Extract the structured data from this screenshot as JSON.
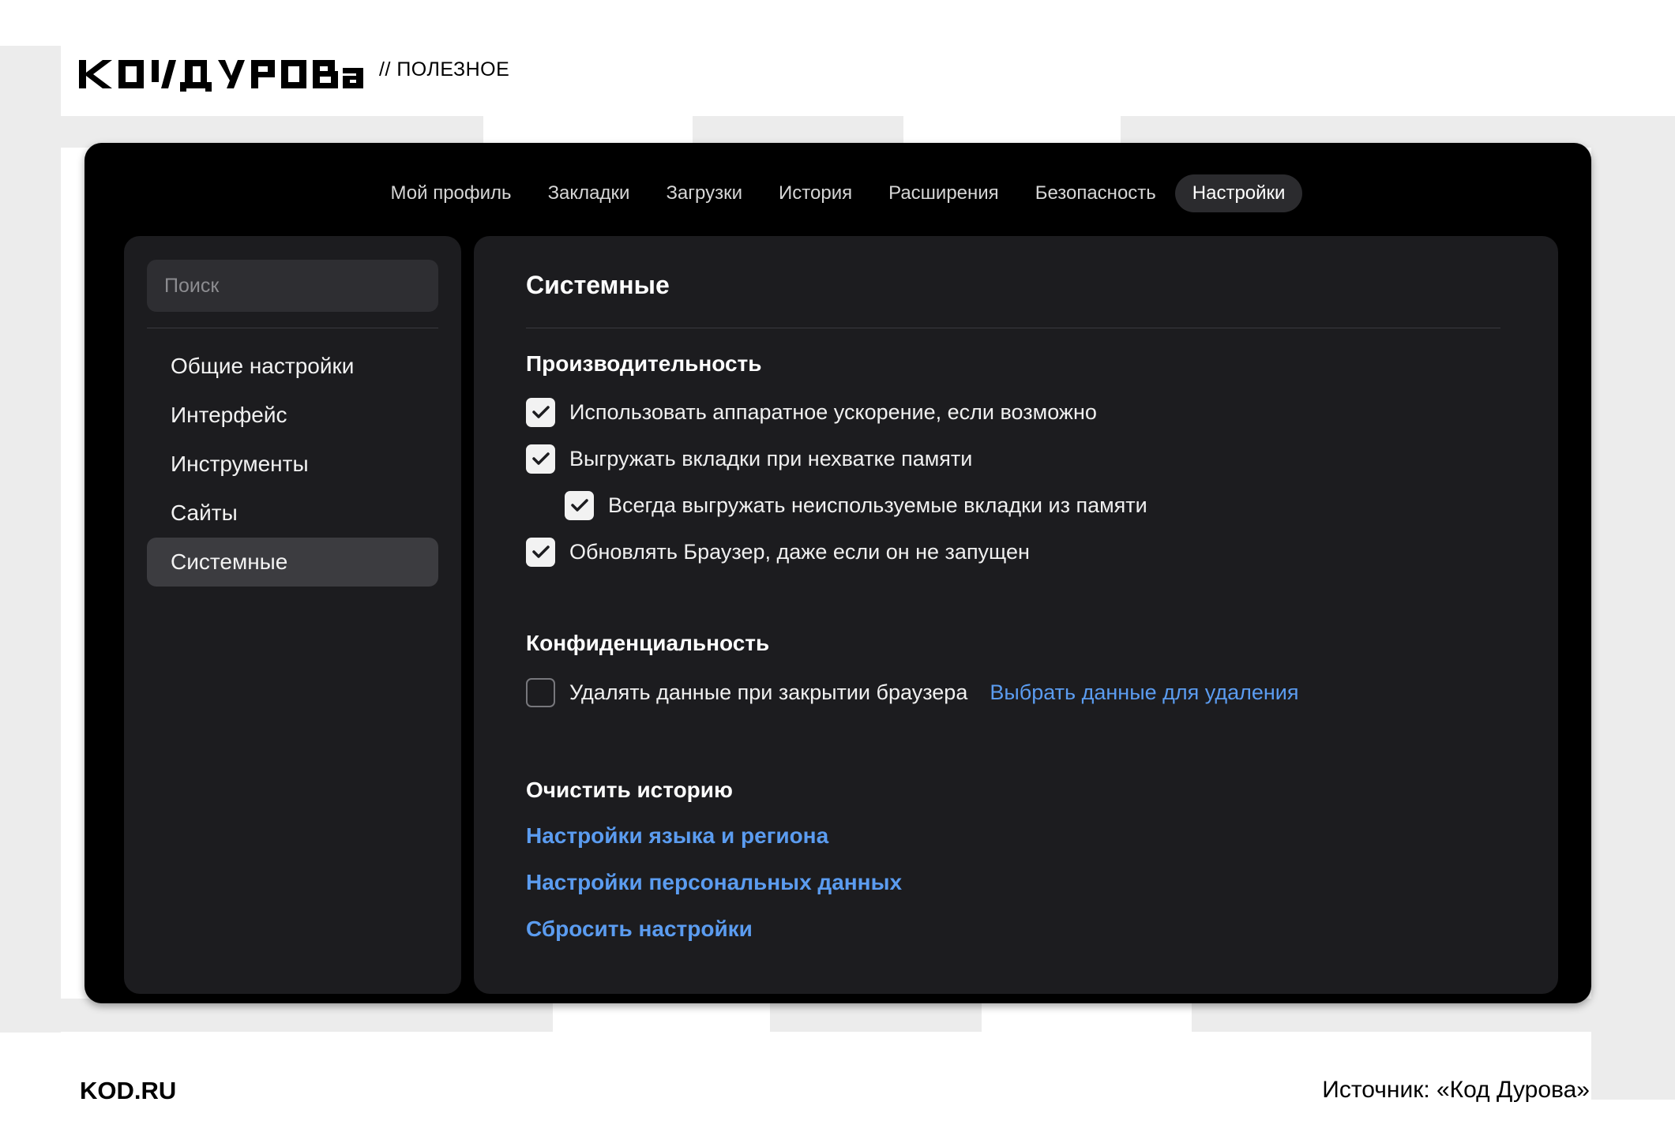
{
  "brand": {
    "logo_text": "КОД ДУРОВА",
    "tag": "// ПОЛЕЗНОЕ"
  },
  "topnav": {
    "tabs": [
      {
        "label": "Мой профиль",
        "active": false
      },
      {
        "label": "Закладки",
        "active": false
      },
      {
        "label": "Загрузки",
        "active": false
      },
      {
        "label": "История",
        "active": false
      },
      {
        "label": "Расширения",
        "active": false
      },
      {
        "label": "Безопасность",
        "active": false
      },
      {
        "label": "Настройки",
        "active": true
      }
    ]
  },
  "sidebar": {
    "search_placeholder": "Поиск",
    "items": [
      {
        "label": "Общие настройки",
        "active": false
      },
      {
        "label": "Интерфейс",
        "active": false
      },
      {
        "label": "Инструменты",
        "active": false
      },
      {
        "label": "Сайты",
        "active": false
      },
      {
        "label": "Системные",
        "active": true
      }
    ]
  },
  "content": {
    "title": "Системные",
    "performance": {
      "heading": "Производительность",
      "options": [
        {
          "label": "Использовать аппаратное ускорение, если возможно",
          "checked": true
        },
        {
          "label": "Выгружать вкладки при нехватке памяти",
          "checked": true
        },
        {
          "label": "Всегда выгружать неиспользуемые вкладки из памяти",
          "checked": true
        },
        {
          "label": "Обновлять Браузер, даже если он не запущен",
          "checked": true
        }
      ]
    },
    "privacy": {
      "heading": "Конфиденциальность",
      "option": {
        "label": "Удалять данные при закрытии браузера",
        "checked": false
      },
      "link": "Выбрать данные для удаления"
    },
    "history": {
      "heading": "Очистить историю",
      "links": [
        "Настройки языка и региона",
        "Настройки персональных данных",
        "Сбросить настройки"
      ]
    }
  },
  "footer": {
    "site": "KOD.RU",
    "source": "Источник: «Код Дурова»"
  },
  "colors": {
    "window_bg": "#000000",
    "panel_bg": "#1c1c1f",
    "link": "#5b9cf0",
    "active_item": "#3c3c40"
  }
}
